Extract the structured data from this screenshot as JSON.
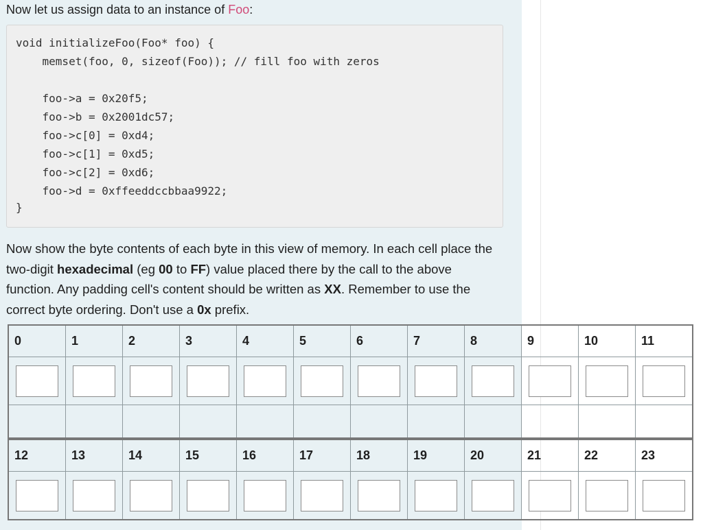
{
  "intro": {
    "text": "Now let us assign data to an instance of ",
    "type_name": "Foo",
    "suffix": ":"
  },
  "code_lines": [
    "void initializeFoo(Foo* foo) {",
    "    memset(foo, 0, sizeof(Foo)); // fill foo with zeros",
    "",
    "    foo->a = 0x20f5;",
    "    foo->b = 0x2001dc57;",
    "    foo->c[0] = 0xd4;",
    "    foo->c[1] = 0xd5;",
    "    foo->c[2] = 0xd6;",
    "    foo->d = 0xffeeddccbbaa9922;",
    "}"
  ],
  "instructions": {
    "p1": "Now show the byte contents of each byte in this view of memory. In each cell place the two-digit ",
    "b1": "hexadecimal",
    "p2": " (eg ",
    "b2": "00",
    "p3": " to ",
    "b3": "FF",
    "p4": ") value placed there by the call to the above function. Any padding cell's content should be written as ",
    "b4": "XX",
    "p5": ". Remember to use the correct byte ordering. Don't use a ",
    "b5": "0x",
    "p6": " prefix."
  },
  "memory_table": {
    "row1_labels": [
      "0",
      "1",
      "2",
      "3",
      "4",
      "5",
      "6",
      "7",
      "8",
      "9",
      "10",
      "11"
    ],
    "row2_labels": [
      "12",
      "13",
      "14",
      "15",
      "16",
      "17",
      "18",
      "19",
      "20",
      "21",
      "22",
      "23"
    ],
    "row1_values": [
      "",
      "",
      "",
      "",
      "",
      "",
      "",
      "",
      "",
      "",
      "",
      ""
    ],
    "row2_values": [
      "",
      "",
      "",
      "",
      "",
      "",
      "",
      "",
      "",
      "",
      "",
      ""
    ]
  }
}
